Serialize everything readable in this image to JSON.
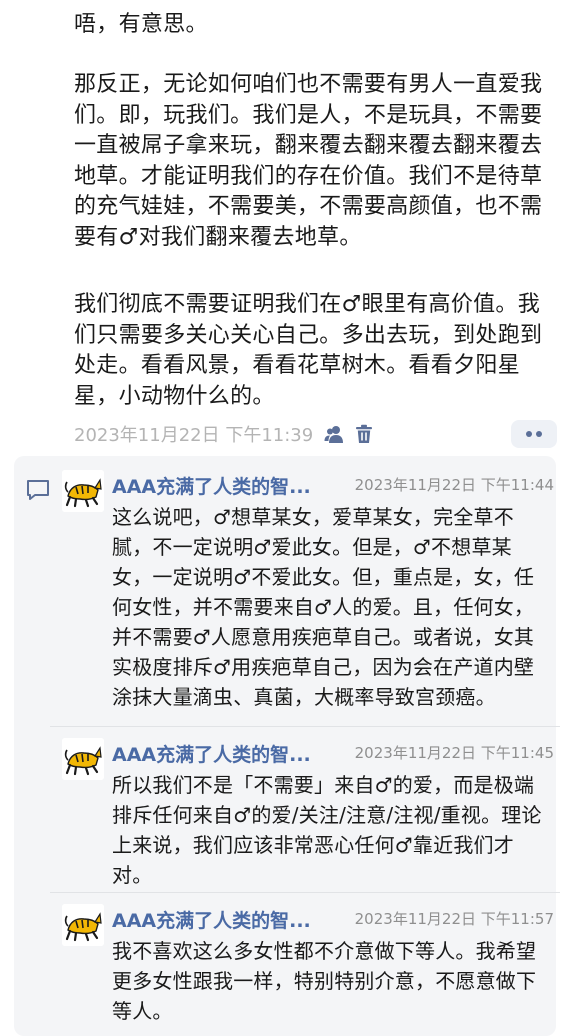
{
  "post": {
    "paragraphs": [
      "唔，有意思。",
      "那反正，无论如何咱们也不需要有男人一直爱我们。即，玩我们。我们是人，不是玩具，不需要一直被屌子拿来玩，翻来覆去翻来覆去翻来覆去地草。才能证明我们的存在价值。我们不是待草的充气娃娃，不需要美，不需要高颜值，也不需要有♂对我们翻来覆去地草。",
      "我们彻底不需要证明我们在♂眼里有高价值。我们只需要多关心关心自己。多出去玩，到处跑到处走。看看风景，看看花草树木。看看夕阳星星，小动物什么的。"
    ],
    "timestamp": "2023年11月22日 下午11:39",
    "icons": {
      "like": "users-icon",
      "delete": "trash-icon",
      "more": "more-dots-icon"
    }
  },
  "comments_panel": {
    "icon": "comment-icon",
    "comments": [
      {
        "author": "AAA充满了人类的智...",
        "time": "2023年11月22日 下午11:44",
        "avatar": "tiger-avatar",
        "text": "这么说吧，♂想草某女，爱草某女，完全草不腻，不一定说明♂爱此女。但是，♂不想草某女，一定说明♂不爱此女。但，重点是，女，任何女性，并不需要来自♂人的爱。且，任何女，并不需要♂人愿意用疾疤草自己。或者说，女其实极度排斥♂用疾疤草自己，因为会在产道内壁涂抹大量滴虫、真菌，大概率导致宫颈癌。"
      },
      {
        "author": "AAA充满了人类的智...",
        "time": "2023年11月22日 下午11:45",
        "avatar": "tiger-avatar",
        "text": "所以我们不是「不需要」来自♂的爱，而是极端排斥任何来自♂的爱/关注/注意/注视/重视。理论上来说，我们应该非常恶心任何♂靠近我们才对。"
      },
      {
        "author": "AAA充满了人类的智...",
        "time": "2023年11月22日 下午11:57",
        "avatar": "tiger-avatar",
        "text": "我不喜欢这么多女性都不介意做下等人。我希望更多女性跟我一样，特别特别介意，不愿意做下等人。"
      }
    ]
  },
  "colors": {
    "author_link": "#4a6aa5",
    "timestamp_gray": "#b4b4b4",
    "panel_bg": "#f4f5f7",
    "icon_blue": "#5b6f98"
  }
}
